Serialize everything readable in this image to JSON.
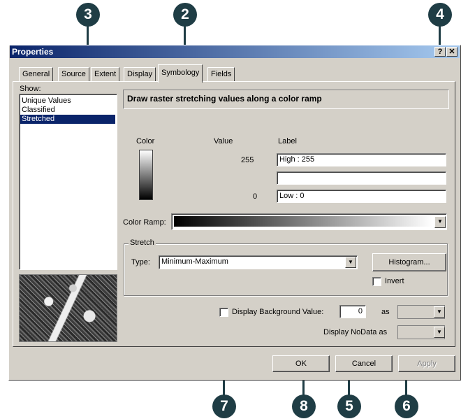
{
  "callouts": {
    "c3": "3",
    "c2": "2",
    "c4": "4",
    "c7": "7",
    "c8": "8",
    "c5": "5",
    "c6": "6"
  },
  "window": {
    "title": "Properties",
    "help_btn": "?",
    "close_btn": "✕"
  },
  "tabs": {
    "general": "General",
    "source": "Source",
    "extent": "Extent",
    "display": "Display",
    "symbology": "Symbology",
    "fields": "Fields"
  },
  "show": {
    "label": "Show:",
    "items": [
      "Unique Values",
      "Classified",
      "Stretched"
    ],
    "selected": "Stretched"
  },
  "header_text": "Draw raster stretching values along a color ramp",
  "columns": {
    "color": "Color",
    "value": "Value",
    "label": "Label"
  },
  "values": {
    "high": "255",
    "low": "0"
  },
  "labels": {
    "high": "High : 255",
    "mid": "",
    "low": "Low : 0"
  },
  "color_ramp": {
    "label": "Color Ramp:"
  },
  "stretch": {
    "group_label": "Stretch",
    "type_label": "Type:",
    "type_value": "Minimum-Maximum",
    "histogram_btn": "Histogram...",
    "invert_label": "Invert"
  },
  "background": {
    "label": "Display Background Value:",
    "value": "0",
    "as": "as",
    "nodata_label": "Display NoData as"
  },
  "buttons": {
    "ok": "OK",
    "cancel": "Cancel",
    "apply": "Apply"
  },
  "colors": {
    "callout": "#1f3d45",
    "title_start": "#0a246a",
    "title_end": "#a6caf0",
    "selection": "#0a246a",
    "face": "#d4d0c8"
  },
  "icons": {
    "dropdown": "chevron-down-icon",
    "preview": "aerial-image-thumbnail"
  }
}
